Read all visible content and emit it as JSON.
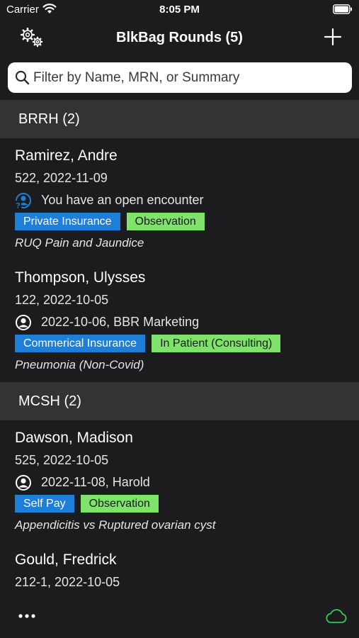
{
  "status_bar": {
    "carrier": "Carrier",
    "time": "8:05 PM"
  },
  "nav": {
    "title": "BlkBag Rounds (5)"
  },
  "search": {
    "placeholder": "Filter by Name, MRN, or Summary",
    "value": ""
  },
  "sections": [
    {
      "title": "BRRH (2)",
      "patients": [
        {
          "name": "Ramirez, Andre",
          "subtitle": "522, 2022-11-09",
          "encounter_icon": "person-question-icon",
          "encounter": "You have an open encounter",
          "tags": [
            {
              "label": "Private Insurance",
              "color": "#1e7fd9"
            },
            {
              "label": "Observation",
              "color": "#7fe26b"
            }
          ],
          "summary": "RUQ Pain and Jaundice"
        },
        {
          "name": "Thompson, Ulysses",
          "subtitle": "122, 2022-10-05",
          "encounter_icon": "person-circle-icon",
          "encounter": "2022-10-06, BBR Marketing",
          "tags": [
            {
              "label": "Commerical Insurance",
              "color": "#1e7fd9"
            },
            {
              "label": "In Patient (Consulting)",
              "color": "#7fe26b"
            }
          ],
          "summary": "Pneumonia (Non-Covid)"
        }
      ]
    },
    {
      "title": "MCSH (2)",
      "patients": [
        {
          "name": "Dawson, Madison",
          "subtitle": "525, 2022-10-05",
          "encounter_icon": "person-circle-icon",
          "encounter": "2022-11-08, Harold",
          "tags": [
            {
              "label": "Self Pay",
              "color": "#1e7fd9"
            },
            {
              "label": "Observation",
              "color": "#7fe26b"
            }
          ],
          "summary": "Appendicitis vs Ruptured ovarian cyst"
        },
        {
          "name": "Gould, Fredrick",
          "subtitle": "212-1, 2022-10-05"
        }
      ]
    }
  ],
  "toolbar": {
    "more_icon": "ellipsis-icon",
    "sync_icon": "cloud-icon",
    "sync_color": "#34c759"
  }
}
